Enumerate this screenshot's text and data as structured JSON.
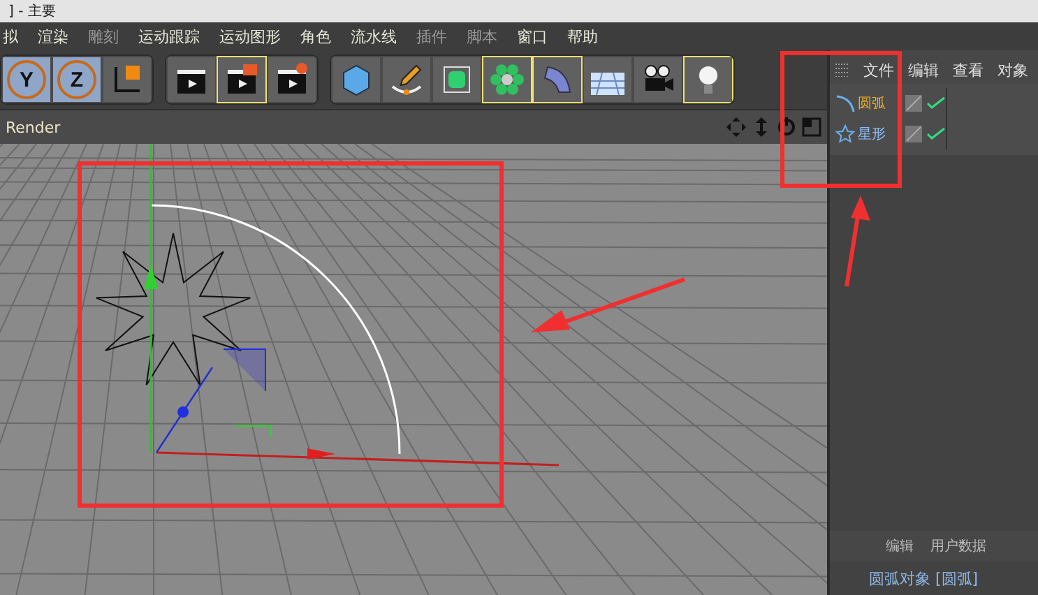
{
  "window": {
    "title": "] - 主要"
  },
  "menu": [
    {
      "label": "拟",
      "disabled": false
    },
    {
      "label": "渲染",
      "disabled": false
    },
    {
      "label": "雕刻",
      "disabled": true
    },
    {
      "label": "运动跟踪",
      "disabled": false
    },
    {
      "label": "运动图形",
      "disabled": false
    },
    {
      "label": "角色",
      "disabled": false
    },
    {
      "label": "流水线",
      "disabled": false
    },
    {
      "label": "插件",
      "disabled": true
    },
    {
      "label": "脚本",
      "disabled": true
    },
    {
      "label": "窗口",
      "disabled": false
    },
    {
      "label": "帮助",
      "disabled": false
    }
  ],
  "toolbar": [
    [
      {
        "kind": "axis",
        "label": "Y",
        "highlighted": false
      },
      {
        "kind": "axis",
        "label": "Z",
        "highlighted": false
      },
      {
        "kind": "coords",
        "highlighted": false
      }
    ],
    [
      {
        "kind": "render-view",
        "highlighted": false
      },
      {
        "kind": "render-picture",
        "highlighted": true
      },
      {
        "kind": "render-settings",
        "highlighted": false
      }
    ],
    [
      {
        "kind": "cube",
        "highlighted": false
      },
      {
        "kind": "pen",
        "highlighted": false
      },
      {
        "kind": "subdivide",
        "highlighted": false
      },
      {
        "kind": "cloner",
        "highlighted": true
      },
      {
        "kind": "bend",
        "highlighted": true
      },
      {
        "kind": "floor",
        "highlighted": false
      },
      {
        "kind": "camera",
        "highlighted": false
      },
      {
        "kind": "light",
        "highlighted": true
      }
    ]
  ],
  "viewport": {
    "title": "Render"
  },
  "object_manager": {
    "menu": [
      "文件",
      "编辑",
      "查看",
      "对象"
    ],
    "objects": [
      {
        "name": "圆弧",
        "kind": "arc",
        "selected": true
      },
      {
        "name": "星形",
        "kind": "star",
        "selected": false
      }
    ]
  },
  "attributes": {
    "tabs": [
      "编辑",
      "用户数据"
    ],
    "title": "圆弧对象 [圆弧]"
  }
}
